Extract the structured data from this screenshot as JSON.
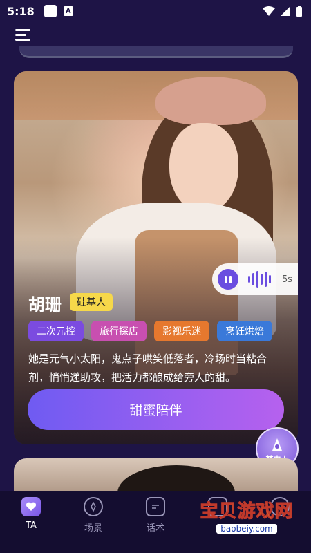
{
  "status_bar": {
    "time": "5:18",
    "notif_letter": "A"
  },
  "card": {
    "name": "胡珊",
    "type_badge": "硅基人",
    "voice_duration": "5s",
    "tags": [
      {
        "label": "二次元控",
        "color": "#7b4be0"
      },
      {
        "label": "旅行探店",
        "color": "#c84fb0"
      },
      {
        "label": "影视乐迷",
        "color": "#e6782e"
      },
      {
        "label": "烹饪烘焙",
        "color": "#3a79d9"
      }
    ],
    "description": "她是元气小太阳，鬼点子哄笑低落者，冷场时当粘合剂，悄悄递助攻，把活力都酿成给旁人的甜。",
    "cta_label": "甜蜜陪伴"
  },
  "float_badge": {
    "label": "梦中人"
  },
  "tabs": [
    {
      "label": "TA",
      "icon": "heart-icon",
      "active": true
    },
    {
      "label": "场景",
      "icon": "compass-icon",
      "active": false
    },
    {
      "label": "话术",
      "icon": "message-icon",
      "active": false
    },
    {
      "label": "",
      "icon": "game-controller-icon",
      "active": false
    },
    {
      "label": "",
      "icon": "profile-icon",
      "active": false
    }
  ],
  "watermark": {
    "title": "宝贝游戏网",
    "url": "baobeiy.com"
  }
}
